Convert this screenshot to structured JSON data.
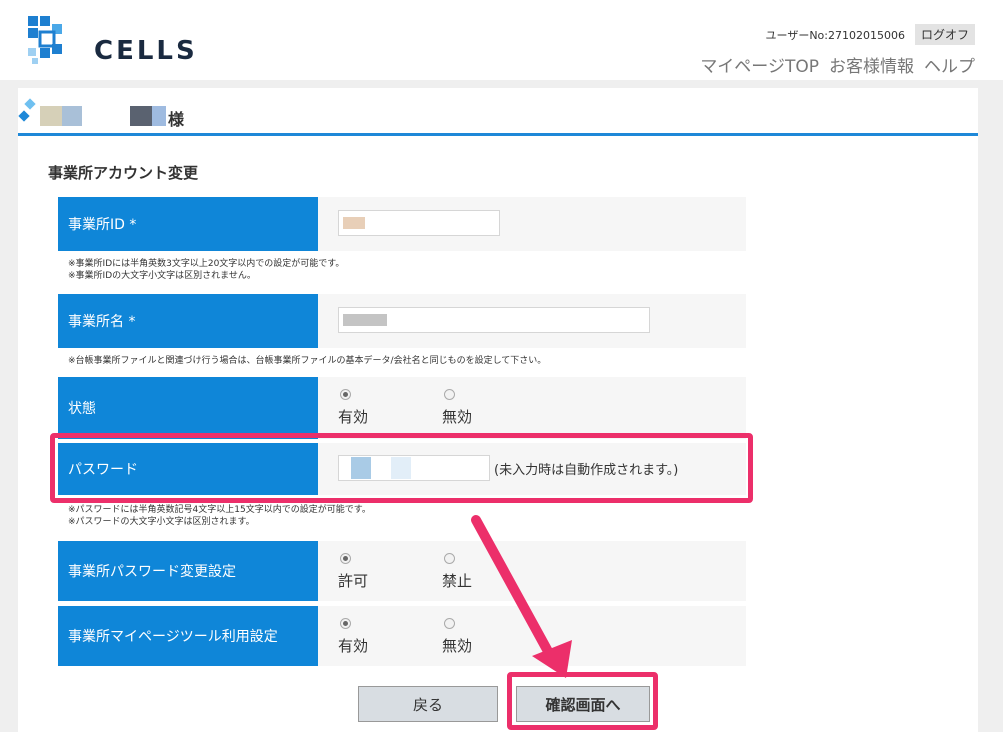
{
  "header": {
    "logo_text": "CELLS",
    "user_label": "ユーザーNo:27102015006",
    "logoff_label": "ログオフ",
    "nav": [
      "マイページTOP",
      "お客様情報",
      "ヘルプ"
    ]
  },
  "namebar": {
    "suffix": "様"
  },
  "form": {
    "title": "事業所アカウント変更",
    "office_id": {
      "label": "事業所ID *",
      "value": "cell-",
      "notes": [
        "※事業所IDには半角英数3文字以上20文字以内での設定が可能です。",
        "※事業所IDの大文字小文字は区別されません。"
      ]
    },
    "office_name": {
      "label": "事業所名 *",
      "notes": [
        "※台帳事業所ファイルと関連づけ行う場合は、台帳事業所ファイルの基本データ/会社名と同じものを設定して下さい。"
      ]
    },
    "status": {
      "label": "状態",
      "options": [
        "有効",
        "無効"
      ],
      "selected": "有効"
    },
    "password": {
      "label": "パスワード",
      "hint": "(未入力時は自動作成されます。)",
      "notes": [
        "※パスワードには半角英数記号4文字以上15文字以内での設定が可能です。",
        "※パスワードの大文字小文字は区別されます。"
      ]
    },
    "pw_change": {
      "label": "事業所パスワード変更設定",
      "options": [
        "許可",
        "禁止"
      ],
      "selected": "許可"
    },
    "mypage_tool": {
      "label": "事業所マイページツール利用設定",
      "options": [
        "有効",
        "無効"
      ],
      "selected": "有効"
    },
    "back_button": "戻る",
    "confirm_button": "確認画面へ"
  },
  "colors": {
    "accent": "#0f86d8",
    "highlight": "#ec2f6a"
  }
}
